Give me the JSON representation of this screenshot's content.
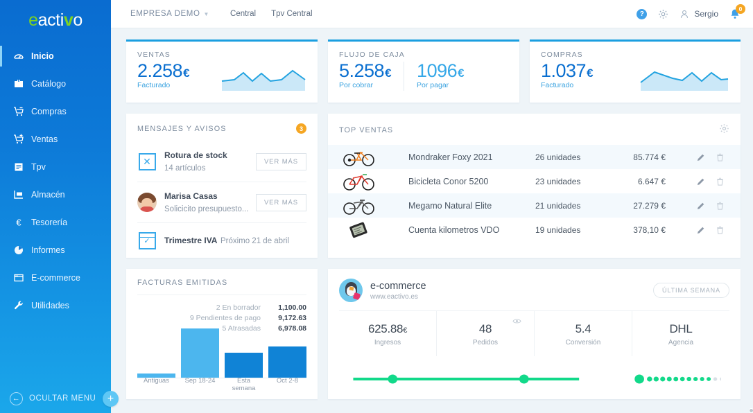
{
  "brand": {
    "logo_e": "e",
    "logo_mid": "acti",
    "logo_v": "v",
    "logo_end": "o"
  },
  "sidebar": {
    "items": [
      {
        "label": "Inicio",
        "icon": "home-icon",
        "active": true
      },
      {
        "label": "Catálogo",
        "icon": "catalog-box-icon",
        "active": false
      },
      {
        "label": "Compras",
        "icon": "cart-minus-icon",
        "active": false
      },
      {
        "label": "Ventas",
        "icon": "cart-plus-icon",
        "active": false
      },
      {
        "label": "Tpv",
        "icon": "receipt-icon",
        "active": false
      },
      {
        "label": "Almacén",
        "icon": "warehouse-icon",
        "active": false
      },
      {
        "label": "Tesorería",
        "icon": "euro-icon",
        "active": false
      },
      {
        "label": "Informes",
        "icon": "pie-chart-icon",
        "active": false
      },
      {
        "label": "E-commerce",
        "icon": "browser-window-icon",
        "active": false
      },
      {
        "label": "Utilidades",
        "icon": "wrench-icon",
        "active": false
      }
    ],
    "hide_menu_label": "OCULTAR MENU",
    "hide_menu_icon": "arrow-left-circle-icon",
    "add_button_label": "+"
  },
  "topbar": {
    "company": "EMPRESA DEMO",
    "caret_icon": "chevron-down-icon",
    "nav": [
      {
        "label": "Central"
      },
      {
        "label": "Tpv Central"
      }
    ],
    "help_icon": "help-circle-icon",
    "help_glyph": "?",
    "settings_icon": "gear-icon",
    "user_icon": "user-icon",
    "user_name": "Sergio",
    "bell_icon": "bell-icon",
    "bell_badge": "0"
  },
  "kpis": [
    {
      "title": "VENTAS",
      "value": "2.258",
      "currency": "€",
      "sublabel": "Facturado",
      "has_spark": true
    },
    {
      "title": "FLUJO DE CAJA",
      "value": "5.258",
      "currency": "€",
      "sublabel": "Por cobrar",
      "value2": "1096",
      "currency2": "€",
      "sublabel2": "Por pagar",
      "has_spark": false
    },
    {
      "title": "COMPRAS",
      "value": "1.037",
      "currency": "€",
      "sublabel": "Facturado",
      "has_spark": true
    }
  ],
  "messages": {
    "title": "MENSAJES Y AVISOS",
    "badge": "3",
    "items": [
      {
        "icon": "stock-break-icon",
        "title": "Rotura de stock",
        "subtitle": "14 artículos",
        "action": "VER MÁS",
        "has_action": true
      },
      {
        "icon": "user-avatar",
        "title": "Marisa Casas",
        "subtitle": "Solicicito presupuesto...",
        "action": "VER MÁS",
        "has_action": true
      },
      {
        "icon": "calendar-check-icon",
        "title": "Trimestre IVA",
        "subtitle": "Próximo 21 de abril",
        "action": "",
        "has_action": false
      }
    ]
  },
  "top_ventas": {
    "title": "TOP VENTAS",
    "gear_icon": "gear-icon",
    "rows": [
      {
        "image": "mountain-bike-icon",
        "name": "Mondraker Foxy 2021",
        "units": "26 unidades",
        "amount": "85.774 €",
        "edit_icon": "pencil-icon",
        "delete_icon": "trash-icon"
      },
      {
        "image": "red-bike-icon",
        "name": "Bicicleta Conor 5200",
        "units": "23 unidades",
        "amount": "6.647 €",
        "edit_icon": "pencil-icon",
        "delete_icon": "trash-icon"
      },
      {
        "image": "white-bike-icon",
        "name": "Megamo Natural Elite",
        "units": "21 unidades",
        "amount": "27.279 €",
        "edit_icon": "pencil-icon",
        "delete_icon": "trash-icon"
      },
      {
        "image": "cyclometer-icon",
        "name": "Cuenta kilometros VDO",
        "units": "19 unidades",
        "amount": "378,10 €",
        "edit_icon": "pencil-icon",
        "delete_icon": "trash-icon"
      }
    ]
  },
  "facturas": {
    "title": "FACTURAS EMITIDAS",
    "legend": [
      {
        "label": "2 En borrador",
        "value": "1,100.00"
      },
      {
        "label": "9 Pendientes de pago",
        "value": "9,172.63"
      },
      {
        "label": "5 Atrasadas",
        "value": "6,978.08"
      }
    ]
  },
  "chart_data": {
    "type": "bar",
    "title": "FACTURAS EMITIDAS",
    "categories": [
      "Antiguas",
      "Sep 18-24",
      "Esta semana",
      "Oct 2-8"
    ],
    "values": [
      6,
      72,
      36,
      46
    ],
    "colors": [
      "#4cb6ee",
      "#4cb6ee",
      "#1083d6",
      "#1083d6"
    ],
    "ylim": [
      0,
      78
    ],
    "xlabel": "",
    "ylabel": "",
    "grid": false,
    "legend_position": "top-right"
  },
  "ecommerce": {
    "avatar_icon": "prestashop-mascot-avatar",
    "name": "e-commerce",
    "url": "www.eactivo.es",
    "period_label": "ÚLTIMA SEMANA",
    "stats": [
      {
        "value": "625.88",
        "currency": "€",
        "label": "Ingresos",
        "has_eye": false
      },
      {
        "value": "48",
        "currency": "",
        "label": "Pedidos",
        "has_eye": true,
        "eye_icon": "eye-icon"
      },
      {
        "value": "5.4",
        "currency": "",
        "label": "Conversión",
        "has_eye": false
      },
      {
        "value": "DHL",
        "currency": "",
        "label": "Agencia",
        "has_eye": false
      }
    ],
    "progress": {
      "accent": "#12d98a",
      "muted": "#d8dfe5",
      "nodes": 3,
      "filled_ratio": 0.62
    }
  }
}
